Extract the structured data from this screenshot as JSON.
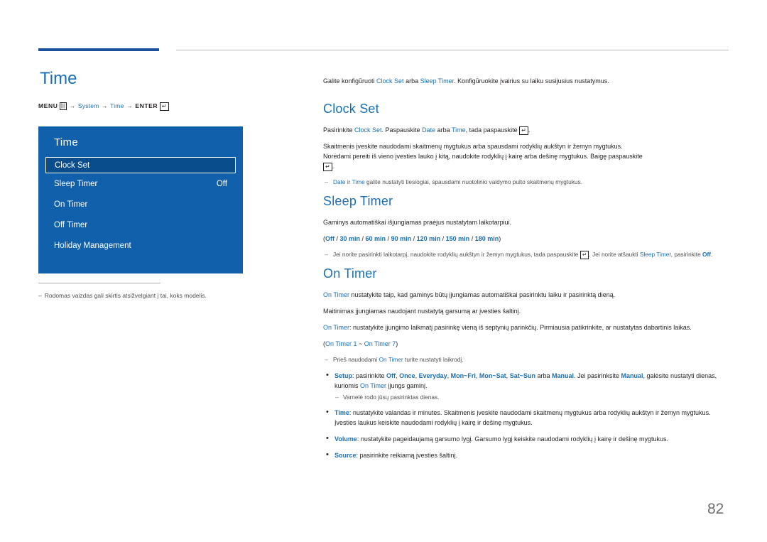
{
  "left": {
    "title": "Time",
    "menu_path": {
      "menu_label": "MENU",
      "menu_icon": "menu-bars-icon",
      "items": [
        "System",
        "Time"
      ],
      "enter_label": "ENTER",
      "enter_icon": "enter-key-icon"
    },
    "osd": {
      "title": "Time",
      "rows": [
        {
          "label": "Clock Set",
          "value": "",
          "selected": true
        },
        {
          "label": "Sleep Timer",
          "value": "Off",
          "selected": false
        },
        {
          "label": "On Timer",
          "value": "",
          "selected": false
        },
        {
          "label": "Off Timer",
          "value": "",
          "selected": false
        },
        {
          "label": "Holiday Management",
          "value": "",
          "selected": false
        }
      ]
    },
    "footnote": "Rodomas vaizdas gali skirtis atsižvelgiant į tai, koks modelis."
  },
  "right": {
    "intro": {
      "pre": "Galite konfigūruoti ",
      "link1": "Clock Set",
      "mid": " arba ",
      "link2": "Sleep Timer",
      "post": ". Konfigūruokite įvairius su laiku susijusius nustatymus."
    },
    "clock_set": {
      "heading": "Clock Set",
      "p1": {
        "a": "Pasirinkite ",
        "l1": "Clock Set",
        "b": ". Paspauskite ",
        "l2": "Date",
        "c": " arba ",
        "l3": "Time",
        "d": ", tada paspauskite ",
        "e": "."
      },
      "p2_line1": "Skaitmenis įveskite naudodami skaitmenų mygtukus arba spausdami rodyklių aukštyn ir žemyn mygtukus.",
      "p2_line2": "Norėdami pereiti iš vieno įvesties lauko į kitą, naudokite rodyklių į kairę arba dešinę mygtukus. Baigę paspauskite",
      "note": {
        "l1": "Date",
        "a": " ir ",
        "l2": "Time",
        "b": " galite nustatyti tiesiogiai, spausdami nuotolinio valdymo pulto skaitmenų mygtukus."
      }
    },
    "sleep_timer": {
      "heading": "Sleep Timer",
      "p1": "Gaminys automatiškai išjungiamas praėjus nustatytam laikotarpiui.",
      "options_prefix": "(",
      "options": [
        "Off",
        "30 min",
        "60 min",
        "90 min",
        "120 min",
        "150 min",
        "180 min"
      ],
      "options_suffix": ")",
      "note": {
        "a": "Jei norite pasirinkti laikotarpį, naudokite rodyklių aukštyn ir žemyn mygtukus, tada paspauskite ",
        "b": ". Jei norite atšaukti ",
        "l1": "Sleep Timer",
        "c": ", pasirinkite ",
        "l2": "Off",
        "d": "."
      }
    },
    "on_timer": {
      "heading": "On Timer",
      "p1": {
        "l1": "On Timer",
        "a": " nustatykite taip, kad gaminys būtų įjungiamas automatiškai pasirinktu laiku ir pasirinktą dieną."
      },
      "p2": "Maitinimas įjungiamas naudojant nustatytą garsumą ar įvesties šaltinį.",
      "p3": {
        "l1": "On Timer",
        "a": ": nustatykite įjungimo laikmatį pasirinkę vieną iš septynių parinkčių. Pirmiausia patikrinkite, ar nustatytas dabartinis laikas."
      },
      "range": {
        "open": "(",
        "l1": "On Timer 1",
        "tilde": " ~ ",
        "l2": "On Timer 7",
        "close": ")"
      },
      "note": {
        "a": "Prieš naudodami ",
        "l1": "On Timer",
        "b": " turite nustatyti laikrodį."
      },
      "bullets": [
        {
          "label": "Setup",
          "text_parts": [
            {
              "t": ": pasirinkite ",
              "style": "plain"
            },
            {
              "t": "Off",
              "style": "blue-b"
            },
            {
              "t": ", ",
              "style": "plain"
            },
            {
              "t": "Once",
              "style": "blue-b"
            },
            {
              "t": ", ",
              "style": "plain"
            },
            {
              "t": "Everyday",
              "style": "blue-b"
            },
            {
              "t": ", ",
              "style": "plain"
            },
            {
              "t": "Mon~Fri",
              "style": "blue-b"
            },
            {
              "t": ", ",
              "style": "plain"
            },
            {
              "t": "Mon~Sat",
              "style": "blue-b"
            },
            {
              "t": ", ",
              "style": "plain"
            },
            {
              "t": "Sat~Sun",
              "style": "blue-b"
            },
            {
              "t": " arba ",
              "style": "plain"
            },
            {
              "t": "Manual",
              "style": "blue-b"
            },
            {
              "t": ". Jei pasirinksite ",
              "style": "plain"
            },
            {
              "t": "Manual",
              "style": "blue-b"
            },
            {
              "t": ", galėsite nustatyti dienas, kuriomis ",
              "style": "plain"
            },
            {
              "t": "On Timer",
              "style": "blue"
            },
            {
              "t": " įjungs gaminį.",
              "style": "plain"
            }
          ],
          "subnote": "Varnelė rodo jūsų pasirinktas dienas."
        },
        {
          "label": "Time",
          "text_parts": [
            {
              "t": ": nustatykite valandas ir minutes. Skaitmenis įveskite naudodami skaitmenų mygtukus arba rodyklių aukštyn ir žemyn mygtukus. Įvesties laukus keiskite naudodami rodyklių į kairę ir dešinę mygtukus.",
              "style": "plain"
            }
          ],
          "subnote": ""
        },
        {
          "label": "Volume",
          "text_parts": [
            {
              "t": ": nustatykite pageidaujamą garsumo lygį. Garsumo lygį keiskite naudodami rodyklių į kairę ir dešinę mygtukus.",
              "style": "plain"
            }
          ],
          "subnote": ""
        },
        {
          "label": "Source",
          "text_parts": [
            {
              "t": ": pasirinkite reikiamą įvesties šaltinį.",
              "style": "plain"
            }
          ],
          "subnote": ""
        }
      ]
    }
  },
  "page_number": "82",
  "colors": {
    "accent_blue": "#1a6fb4",
    "osd_bg": "#1060ab",
    "osd_selected_bg": "#0a4d8c",
    "rule_blue": "#1a4f9c"
  }
}
